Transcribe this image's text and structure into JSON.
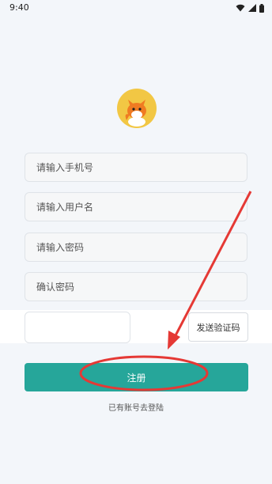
{
  "status_bar": {
    "time": "9:40"
  },
  "form": {
    "phone_placeholder": "请输入手机号",
    "username_placeholder": "请输入用户名",
    "password_placeholder": "请输入密码",
    "confirm_placeholder": "确认密码",
    "code_value": "",
    "send_code_label": "发送验证码",
    "register_label": "注册",
    "login_link": "已有账号去登陆"
  },
  "colors": {
    "primary": "#26a69a",
    "annotation": "#e53935",
    "logo_bg": "#f2c744"
  },
  "icons": [
    "wifi-icon",
    "signal-icon",
    "battery-icon",
    "fox-logo"
  ]
}
